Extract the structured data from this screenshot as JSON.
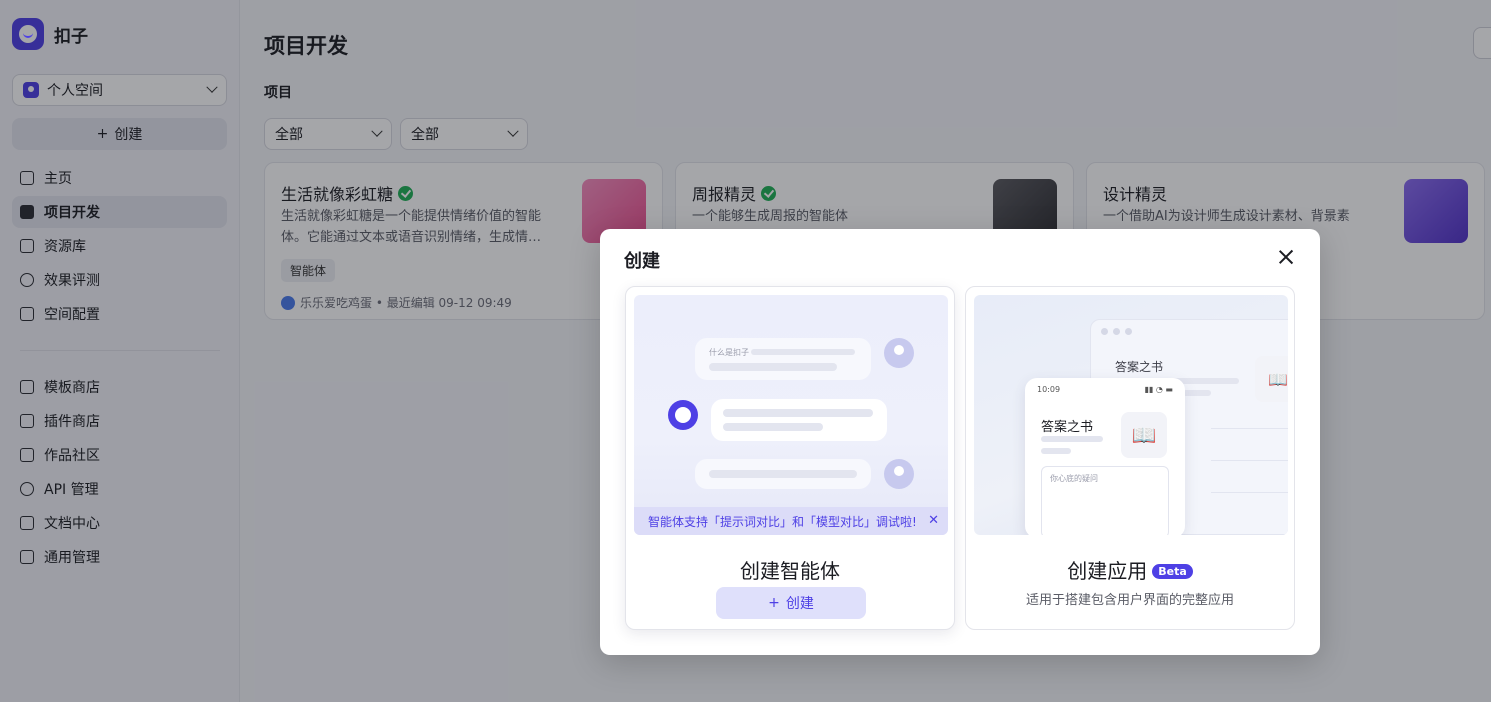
{
  "brand": {
    "name": "扣子"
  },
  "sidebar": {
    "space": "个人空间",
    "create_label": "创建",
    "nav_primary": [
      {
        "label": "主页",
        "icon": "home-icon"
      },
      {
        "label": "项目开发",
        "icon": "project-icon",
        "active": true
      },
      {
        "label": "资源库",
        "icon": "library-icon"
      },
      {
        "label": "效果评测",
        "icon": "evaluation-icon"
      },
      {
        "label": "空间配置",
        "icon": "space-config-icon"
      }
    ],
    "nav_secondary": [
      {
        "label": "模板商店",
        "icon": "template-store-icon"
      },
      {
        "label": "插件商店",
        "icon": "plugin-store-icon"
      },
      {
        "label": "作品社区",
        "icon": "community-icon"
      },
      {
        "label": "API 管理",
        "icon": "api-icon"
      },
      {
        "label": "文档中心",
        "icon": "docs-icon"
      },
      {
        "label": "通用管理",
        "icon": "management-icon"
      }
    ]
  },
  "main": {
    "title": "项目开发",
    "section": "项目",
    "filters": [
      "全部",
      "全部"
    ],
    "cards": [
      {
        "title": "生活就像彩虹糖",
        "desc": "生活就像彩虹糖是一个能提供情绪价值的智能体。它能通过文本或语音识别情绪，生成情…",
        "tag": "智能体",
        "meta": "乐乐爱吃鸡蛋 • 最近编辑 09-12 09:49",
        "thumb_color": "#f26aa5"
      },
      {
        "title": "周报精灵",
        "desc": "一个能够生成周报的智能体",
        "thumb_color": "#3a3a3e"
      },
      {
        "title": "设计精灵",
        "desc": "一个借助AI为设计师生成设计素材、背景素",
        "thumb_color": "#6b4fd8"
      }
    ]
  },
  "modal": {
    "title": "创建",
    "agent": {
      "title": "创建智能体",
      "button": "创建",
      "preview_question": "什么是扣子",
      "notice": "智能体支持「提示词对比」和「模型对比」调试啦!"
    },
    "app": {
      "title": "创建应用",
      "badge": "Beta",
      "subtitle": "适用于搭建包含用户界面的完整应用",
      "preview_title": "答案之书",
      "preview_time": "10:09",
      "preview_placeholder": "你心底的疑问"
    }
  }
}
